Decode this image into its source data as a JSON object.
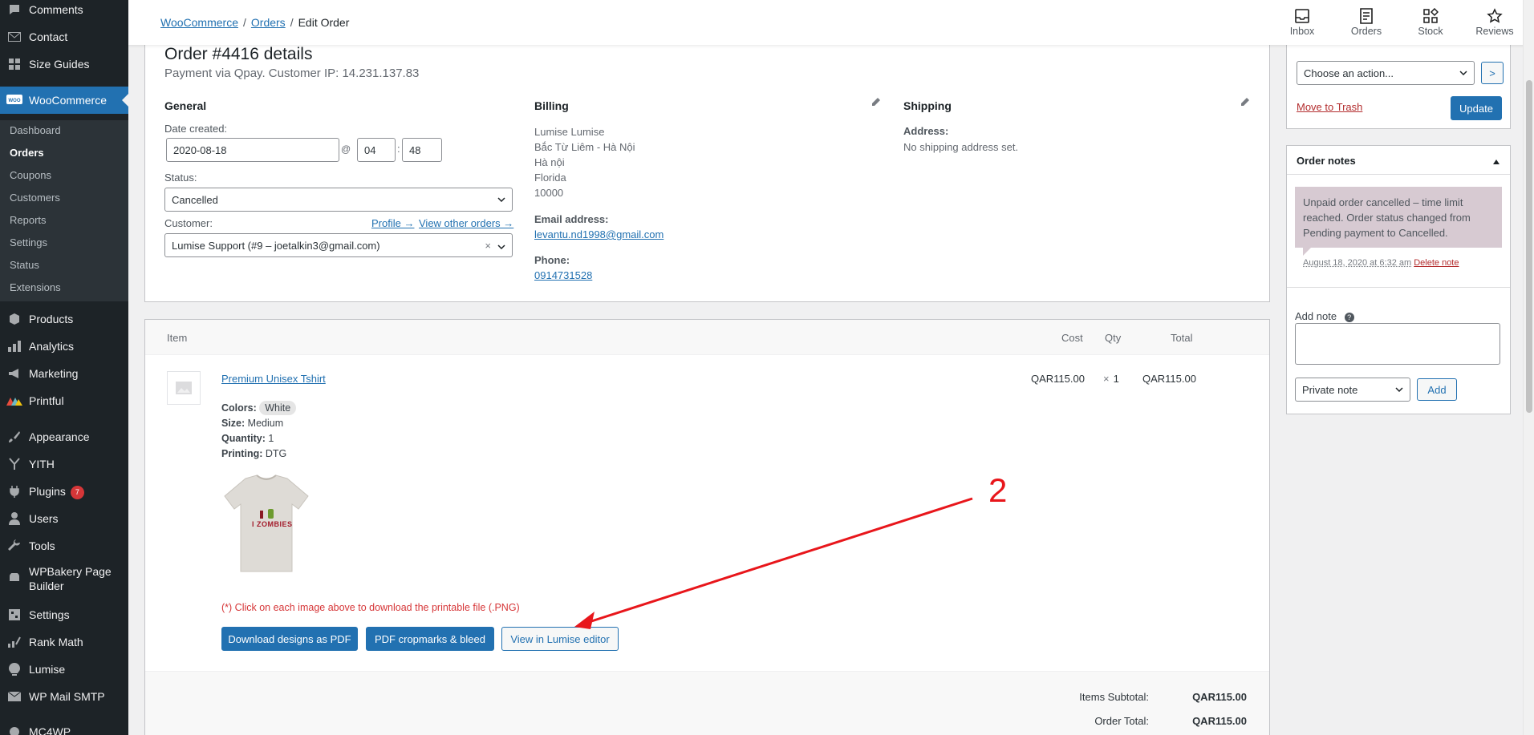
{
  "sidebar": {
    "items": [
      {
        "label": "Comments",
        "icon": "comments-icon"
      },
      {
        "label": "Contact",
        "icon": "envelope-icon"
      },
      {
        "label": "Size Guides",
        "icon": "grid-icon"
      },
      {
        "label": "WooCommerce",
        "icon": "woocommerce-icon"
      },
      {
        "label": "Products",
        "icon": "products-icon"
      },
      {
        "label": "Analytics",
        "icon": "bar-chart-icon"
      },
      {
        "label": "Marketing",
        "icon": "megaphone-icon"
      },
      {
        "label": "Printful",
        "icon": "printful-icon"
      },
      {
        "label": "Appearance",
        "icon": "paintbrush-icon"
      },
      {
        "label": "YITH",
        "icon": "yith-icon"
      },
      {
        "label": "Plugins",
        "icon": "plug-icon",
        "badge": "7"
      },
      {
        "label": "Users",
        "icon": "user-icon"
      },
      {
        "label": "Tools",
        "icon": "wrench-icon"
      },
      {
        "label": "WPBakery Page Builder",
        "icon": "wpbakery-icon"
      },
      {
        "label": "Settings",
        "icon": "settings-icon"
      },
      {
        "label": "Rank Math",
        "icon": "rank-math-icon"
      },
      {
        "label": "Lumise",
        "icon": "lumise-icon"
      },
      {
        "label": "WP Mail SMTP",
        "icon": "mail-icon"
      },
      {
        "label": "MC4WP",
        "icon": "mc4wp-icon"
      }
    ],
    "submenu": [
      "Dashboard",
      "Orders",
      "Coupons",
      "Customers",
      "Reports",
      "Settings",
      "Status",
      "Extensions"
    ]
  },
  "breadcrumb": {
    "woocommerce": "WooCommerce",
    "orders": "Orders",
    "current": "Edit Order"
  },
  "top_actions": [
    {
      "label": "Inbox",
      "icon": "inbox-icon"
    },
    {
      "label": "Orders",
      "icon": "orders-icon"
    },
    {
      "label": "Stock",
      "icon": "stock-icon"
    },
    {
      "label": "Reviews",
      "icon": "star-icon"
    }
  ],
  "order": {
    "title": "Order #4416 details",
    "subtitle": "Payment via Qpay. Customer IP: 14.231.137.83",
    "general": {
      "heading": "General",
      "date_label": "Date created:",
      "date": "2020-08-18",
      "at": "@",
      "hour": "04",
      "colon": ":",
      "minute": "48",
      "status_label": "Status:",
      "status": "Cancelled",
      "customer_label": "Customer:",
      "profile_link": "Profile →",
      "other_orders_link": "View other orders →",
      "customer": "Lumise Support (#9 – joetalkin3@gmail.com)",
      "clear": "×"
    },
    "billing": {
      "heading": "Billing",
      "address_lines": [
        "Lumise Lumise",
        "Bắc Từ Liêm - Hà Nội",
        "Hà nội",
        "Florida",
        "10000"
      ],
      "email_label": "Email address:",
      "email": "levantu.nd1998@gmail.com",
      "phone_label": "Phone:",
      "phone": "0914731528"
    },
    "shipping": {
      "heading": "Shipping",
      "address_label": "Address:",
      "address": "No shipping address set."
    }
  },
  "items": {
    "headers": {
      "item": "Item",
      "cost": "Cost",
      "qty": "Qty",
      "total": "Total"
    },
    "product": {
      "name": "Premium Unisex Tshirt",
      "cost": "QAR115.00",
      "qty_prefix": "×",
      "qty": "1",
      "total": "QAR115.00",
      "meta": [
        {
          "key": "Colors:",
          "value": "White"
        },
        {
          "key": "Size:",
          "value": "Medium"
        },
        {
          "key": "Quantity:",
          "value": "1"
        },
        {
          "key": "Printing:",
          "value": "DTG"
        }
      ],
      "shirt_print": "I ZOMBIES"
    },
    "download_note": "(*) Click on each image above to download the printable file (.PNG)",
    "buttons": {
      "download_pdf": "Download designs as PDF",
      "cropmarks": "PDF cropmarks & bleed",
      "view_editor": "View in Lumise editor"
    },
    "annotation": "2",
    "totals": {
      "subtotal_label": "Items Subtotal:",
      "subtotal": "QAR115.00",
      "order_total_label": "Order Total:",
      "order_total": "QAR115.00"
    }
  },
  "actions": {
    "select": "Choose an action...",
    "go": ">",
    "trash": "Move to Trash",
    "update": "Update"
  },
  "notes": {
    "heading": "Order notes",
    "note_text": "Unpaid order cancelled – time limit reached. Order status changed from Pending payment to Cancelled.",
    "note_meta": "August 18, 2020 at 6:32 am",
    "delete": "Delete note",
    "add_label": "Add note",
    "help": "?",
    "type": "Private note",
    "add_button": "Add"
  },
  "colors": {
    "accent": "#2271b1",
    "sidebar": "#1d2327",
    "annotation": "#e8161b",
    "note": "#d7cad2"
  }
}
